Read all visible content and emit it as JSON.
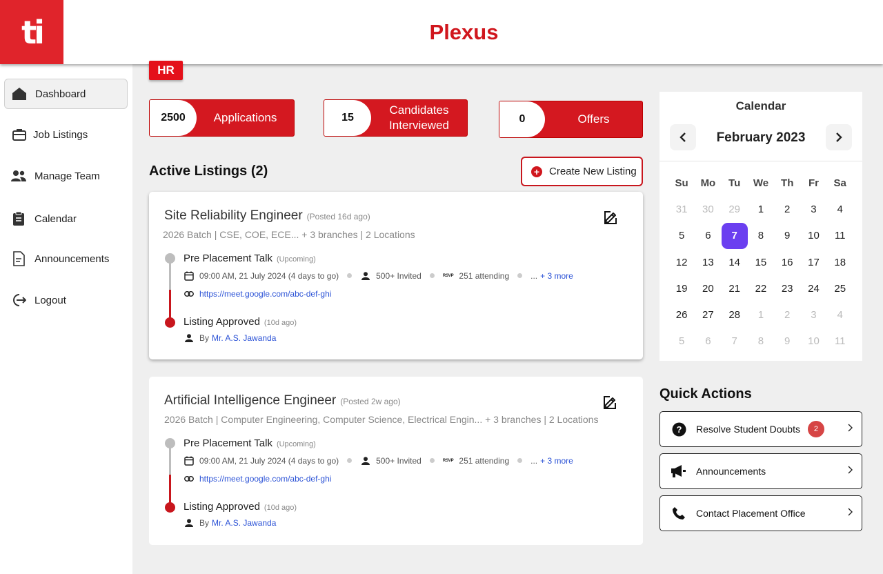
{
  "header": {
    "logo_text": "ti",
    "app_title": "Plexus"
  },
  "role_tag": "HR",
  "sidebar": {
    "items": [
      {
        "label": "Dashboard",
        "icon": "home-icon",
        "active": true
      },
      {
        "label": "Job Listings",
        "icon": "briefcase-icon"
      },
      {
        "label": "Manage Team",
        "icon": "people-icon"
      },
      {
        "label": "Calendar",
        "icon": "clipboard-icon"
      },
      {
        "label": "Announcements",
        "icon": "document-icon"
      },
      {
        "label": "Logout",
        "icon": "logout-icon"
      }
    ]
  },
  "stats": [
    {
      "value": "2500",
      "label": "Applications"
    },
    {
      "value": "15",
      "label": "Candidates Interviewed"
    },
    {
      "value": "0",
      "label": "Offers"
    }
  ],
  "listings_section": {
    "title": "Active Listings (2)",
    "create_label": "Create New Listing"
  },
  "listings": [
    {
      "title": "Site Reliability Engineer",
      "posted": "(Posted 16d ago)",
      "subtitle": "2026 Batch | CSE, COE, ECE... + 3 branches | 2 Locations",
      "event_title": "Pre Placement Talk",
      "event_tag": "(Upcoming)",
      "event_time": "09:00 AM, 21 July 2024 (4 days to go)",
      "invited": "500+ Invited",
      "rsvp_badge": "RSVP",
      "attending": "251 attending",
      "more_prefix": "...",
      "more_link": "+ 3 more",
      "meet_link": "https://meet.google.com/abc-def-ghi",
      "approved_title": "Listing Approved",
      "approved_tag": "(10d ago)",
      "approved_by_prefix": "By",
      "approved_by": "Mr. A.S. Jawanda"
    },
    {
      "title": "Artificial Intelligence Engineer",
      "posted": "(Posted 2w ago)",
      "subtitle": "2026 Batch | Computer Engineering, Computer Science, Electrical Engin... + 3 branches | 2 Locations",
      "event_title": "Pre Placement Talk",
      "event_tag": "(Upcoming)",
      "event_time": "09:00 AM, 21 July 2024 (4 days to go)",
      "invited": "500+ Invited",
      "rsvp_badge": "RSVP",
      "attending": "251 attending",
      "more_prefix": "...",
      "more_link": "+ 3 more",
      "meet_link": "https://meet.google.com/abc-def-ghi",
      "approved_title": "Listing Approved",
      "approved_tag": "(10d ago)",
      "approved_by_prefix": "By",
      "approved_by": "Mr. A.S. Jawanda"
    }
  ],
  "calendar": {
    "title": "Calendar",
    "month": "February 2023",
    "weekdays": [
      "Su",
      "Mo",
      "Tu",
      "We",
      "Th",
      "Fr",
      "Sa"
    ],
    "days": [
      {
        "d": "31",
        "m": true
      },
      {
        "d": "30",
        "m": true
      },
      {
        "d": "29",
        "m": true
      },
      {
        "d": "1"
      },
      {
        "d": "2"
      },
      {
        "d": "3"
      },
      {
        "d": "4"
      },
      {
        "d": "5"
      },
      {
        "d": "6"
      },
      {
        "d": "7",
        "sel": true
      },
      {
        "d": "8"
      },
      {
        "d": "9"
      },
      {
        "d": "10"
      },
      {
        "d": "11"
      },
      {
        "d": "12"
      },
      {
        "d": "13"
      },
      {
        "d": "14"
      },
      {
        "d": "15"
      },
      {
        "d": "16"
      },
      {
        "d": "17"
      },
      {
        "d": "18"
      },
      {
        "d": "19"
      },
      {
        "d": "20"
      },
      {
        "d": "21"
      },
      {
        "d": "22"
      },
      {
        "d": "23"
      },
      {
        "d": "24"
      },
      {
        "d": "25"
      },
      {
        "d": "26"
      },
      {
        "d": "27"
      },
      {
        "d": "28"
      },
      {
        "d": "1",
        "m": true
      },
      {
        "d": "2",
        "m": true
      },
      {
        "d": "3",
        "m": true
      },
      {
        "d": "4",
        "m": true
      },
      {
        "d": "5",
        "m": true
      },
      {
        "d": "6",
        "m": true
      },
      {
        "d": "7",
        "m": true
      },
      {
        "d": "8",
        "m": true
      },
      {
        "d": "9",
        "m": true
      },
      {
        "d": "10",
        "m": true
      },
      {
        "d": "11",
        "m": true
      }
    ],
    "selected_color": "#6b3ff0"
  },
  "quick_actions": {
    "title": "Quick Actions",
    "items": [
      {
        "label": "Resolve Student Doubts",
        "icon": "question-icon",
        "badge": "2"
      },
      {
        "label": "Announcements",
        "icon": "megaphone-icon"
      },
      {
        "label": "Contact Placement Office",
        "icon": "phone-icon"
      }
    ]
  },
  "colors": {
    "brand_red": "#d41820",
    "link_blue": "#2b52d6"
  }
}
